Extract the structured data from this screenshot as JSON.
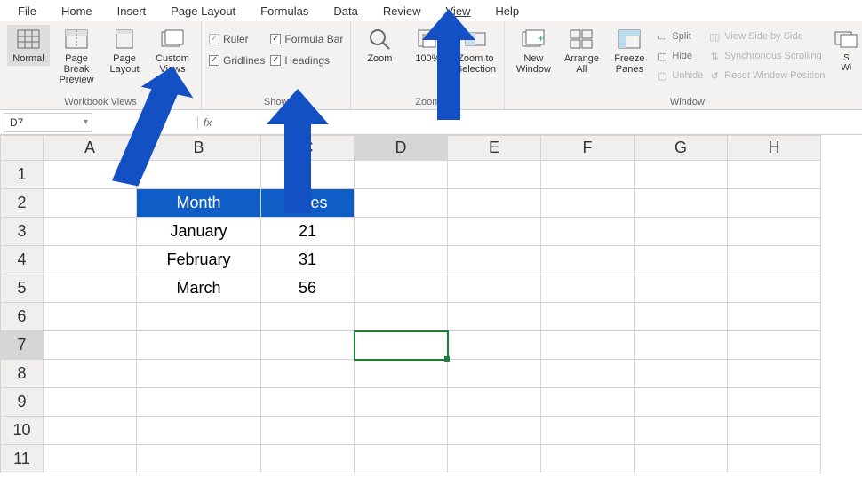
{
  "menu": {
    "tabs": [
      "File",
      "Home",
      "Insert",
      "Page Layout",
      "Formulas",
      "Data",
      "Review",
      "View",
      "Help"
    ],
    "active": "View"
  },
  "ribbon": {
    "group_views": {
      "label": "Workbook Views",
      "normal": "Normal",
      "page_break": "Page Break Preview",
      "page_layout": "Page Layout",
      "custom_views": "Custom Views"
    },
    "group_show": {
      "label": "Show",
      "ruler": "Ruler",
      "formula_bar": "Formula Bar",
      "gridlines": "Gridlines",
      "headings": "Headings"
    },
    "group_zoom": {
      "label": "Zoom",
      "zoom": "Zoom",
      "hundred": "100%",
      "to_selection": "Zoom to Selection"
    },
    "group_window": {
      "label": "Window",
      "new_window": "New Window",
      "arrange_all": "Arrange All",
      "freeze_panes": "Freeze Panes",
      "split": "Split",
      "hide": "Hide",
      "unhide": "Unhide",
      "side_by_side": "View Side by Side",
      "sync_scroll": "Synchronous Scrolling",
      "reset_pos": "Reset Window Position",
      "switch": "Switch Windows"
    }
  },
  "formula_bar": {
    "cell_ref": "D7",
    "fx": "fx",
    "value": ""
  },
  "grid": {
    "columns": [
      "A",
      "B",
      "C",
      "D",
      "E",
      "F",
      "G",
      "H"
    ],
    "rows": [
      "1",
      "2",
      "3",
      "4",
      "5",
      "6",
      "7",
      "8",
      "9",
      "10",
      "11"
    ],
    "selected_col": "D",
    "selected_row": "7",
    "header": {
      "b2": "Month",
      "c2": "Sales"
    },
    "data": [
      {
        "month": "January",
        "sales": "21"
      },
      {
        "month": "February",
        "sales": "31"
      },
      {
        "month": "March",
        "sales": "56"
      }
    ]
  },
  "chart_data": {
    "type": "table",
    "columns": [
      "Month",
      "Sales"
    ],
    "rows": [
      [
        "January",
        21
      ],
      [
        "February",
        31
      ],
      [
        "March",
        56
      ]
    ]
  }
}
